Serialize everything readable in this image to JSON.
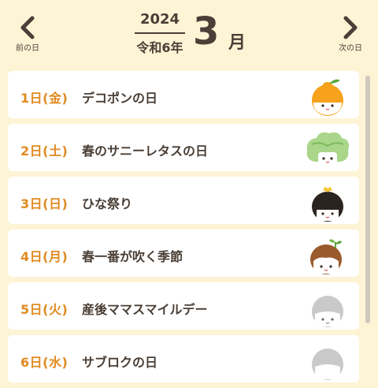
{
  "header": {
    "prev_label": "前の日",
    "next_label": "次の日",
    "year": "2024",
    "era": "令和6年",
    "month": "3",
    "month_unit": "月"
  },
  "days": [
    {
      "date": "1日(金)",
      "title": "デコポンの日",
      "icon": "dekopon-character-icon"
    },
    {
      "date": "2日(土)",
      "title": "春のサニーレタスの日",
      "icon": "lettuce-character-icon"
    },
    {
      "date": "3日(日)",
      "title": "ひな祭り",
      "icon": "hina-doll-character-icon"
    },
    {
      "date": "4日(月)",
      "title": "春一番が吹く季節",
      "icon": "sprout-girl-character-icon"
    },
    {
      "date": "5日(火)",
      "title": "産後ママスマイルデー",
      "icon": "gray-character-icon"
    },
    {
      "date": "6日(水)",
      "title": "サブロクの日",
      "icon": "gray-character-icon"
    }
  ],
  "colors": {
    "background": "#fdf4d6",
    "date_accent": "#e08a22",
    "text": "#4a3f36"
  }
}
